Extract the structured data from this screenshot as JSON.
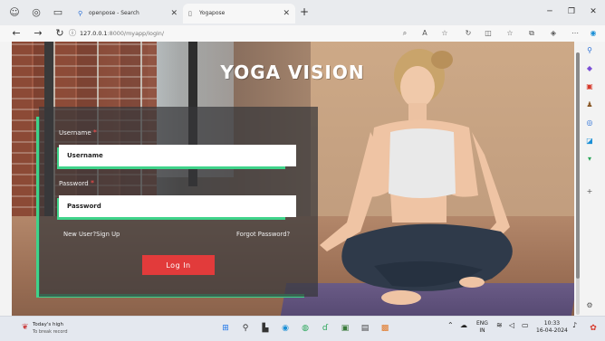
{
  "browser": {
    "tabs": [
      {
        "label": "openpose - Search",
        "active": false
      },
      {
        "label": "Yogapose",
        "active": true
      }
    ],
    "url_host": "127.0.0.1",
    "url_path": ":8000/myapp/login/"
  },
  "page": {
    "title": "YOGA VISION",
    "username_label": "Username",
    "username_placeholder": "Username",
    "password_label": "Password",
    "password_placeholder": "Password",
    "required_mark": "*",
    "new_user_link": "New User?Sign Up",
    "forgot_link": "Forgot Password?",
    "login_label": "Log In",
    "accent_color": "#3fd38a",
    "button_color": "#e23b3b"
  },
  "taskbar": {
    "weather_title": "Today's high",
    "weather_sub": "To break record",
    "lang_top": "ENG",
    "lang_bottom": "IN",
    "time": "10:33",
    "date": "16-04-2024"
  }
}
